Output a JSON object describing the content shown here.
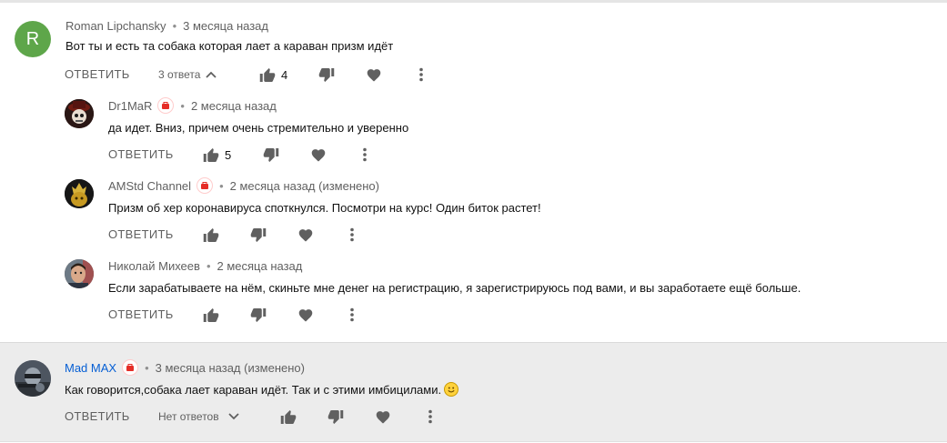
{
  "threads": [
    {
      "author": "Roman Lipchansky",
      "avatar_letter": "R",
      "avatar_color": "#5ea64a",
      "time": "3 месяца назад",
      "text": "Вот ты и есть та собака которая лает а караван призм идёт",
      "reply_label": "ОТВЕТИТЬ",
      "replies_label": "3 ответа",
      "like_count": "4",
      "replies": [
        {
          "author": "Dr1MaR",
          "time": "2 месяца назад",
          "text": "да идет. Вниз, причем очень стремительно и уверенно",
          "reply_label": "ОТВЕТИТЬ",
          "like_count": "5"
        },
        {
          "author": "AMStd Channel",
          "time": "2 месяца назад (изменено)",
          "text": "Призм об хер коронавируса споткнулся. Посмотри на курс! Один биток растет!",
          "reply_label": "ОТВЕТИТЬ",
          "like_count": ""
        },
        {
          "author": "Николай Михеев",
          "time": "2 месяца назад",
          "text": "Если зарабатываете на нём, скиньте мне денег на регистрацию, я зарегистрируюсь под вами, и вы заработаете ещё больше.",
          "reply_label": "ОТВЕТИТЬ",
          "like_count": ""
        }
      ]
    },
    {
      "author": "Mad MAX",
      "time": "3 месяца назад (изменено)",
      "text": "Как говорится,собака лает караван идёт. Так и с этими имбицилами.",
      "reply_label": "ОТВЕТИТЬ",
      "replies_label": "Нет ответов",
      "like_count": ""
    }
  ],
  "icons": {
    "like": "thumb-up-icon",
    "dislike": "thumb-down-icon",
    "heart": "heart-icon",
    "more": "more-vert-icon",
    "badge": "youtube-badge-icon",
    "chevron_up": "chevron-up-icon",
    "chevron_down": "chevron-down-icon",
    "emoji": "smile-emoji-icon"
  },
  "colors": {
    "author_link": "#065fd4",
    "secondary_text": "#606060",
    "badge_red": "#e52d27",
    "highlight_bg": "#ececec"
  }
}
